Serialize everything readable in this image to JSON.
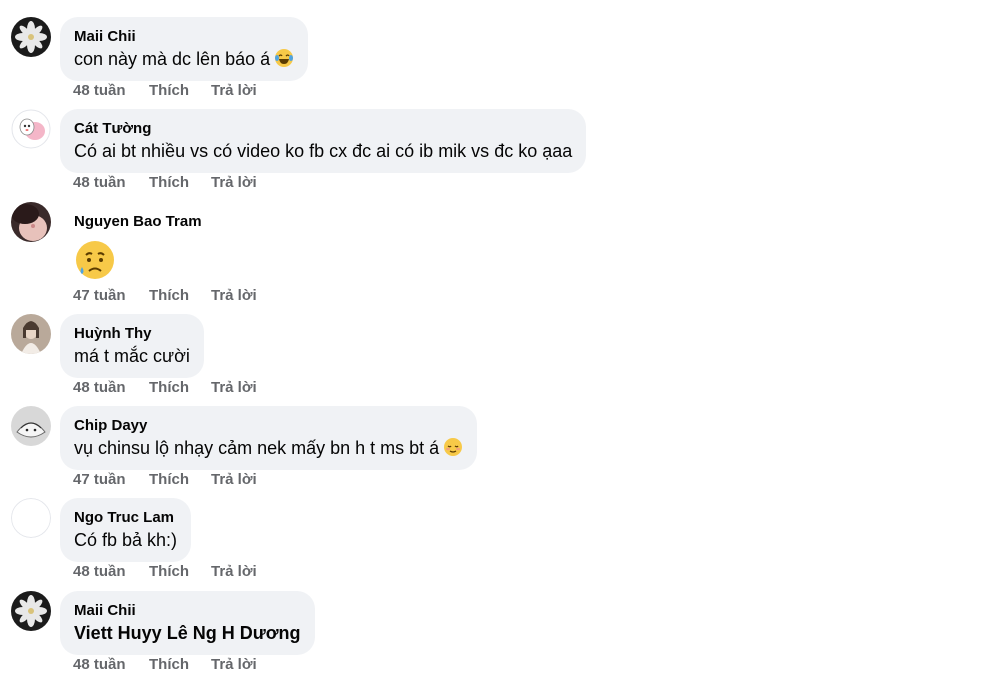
{
  "comments": [
    {
      "author": "Maii Chii",
      "text": "con này mà dc lên báo á",
      "emoji": "laughing-tears",
      "time": "48 tuần",
      "like": "Thích",
      "reply": "Trả lời"
    },
    {
      "author": "Cát Tường",
      "text": "Có ai bt nhiều vs có video ko fb cx đc ai có ib mik vs đc ko ạaa",
      "time": "48 tuần",
      "like": "Thích",
      "reply": "Trả lời"
    },
    {
      "author": "Nguyen Bao Tram",
      "text": "",
      "emoji": "sad-sweat",
      "time": "47 tuần",
      "like": "Thích",
      "reply": "Trả lời"
    },
    {
      "author": "Huỳnh Thy",
      "text": "má t mắc cười",
      "time": "48 tuần",
      "like": "Thích",
      "reply": "Trả lời"
    },
    {
      "author": "Chip Dayy",
      "text": "vụ chinsu lộ nhạy cảm nek mấy bn h t ms bt á",
      "emoji": "relieved",
      "time": "47 tuần",
      "like": "Thích",
      "reply": "Trả lời"
    },
    {
      "author": "Ngo Truc Lam",
      "text": "Có fb bả kh:)",
      "time": "48 tuần",
      "like": "Thích",
      "reply": "Trả lời"
    },
    {
      "author": "Maii Chii",
      "text": "Viett Huyy Lê Ng H Dương",
      "time": "48 tuần",
      "like": "Thích",
      "reply": "Trả lời"
    }
  ],
  "colors": {
    "bubble": "#f0f2f5",
    "meta": "#65676b",
    "text": "#050505"
  }
}
